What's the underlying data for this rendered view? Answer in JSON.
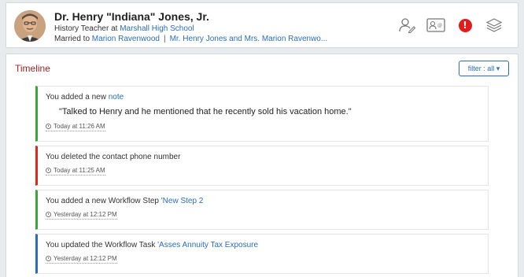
{
  "profile": {
    "name": "Dr. Henry \"Indiana\" Jones, Jr.",
    "role_prefix": "History Teacher at ",
    "school": "Marshall High School",
    "married_prefix": "Married to ",
    "spouse": "Marion Ravenwood",
    "separator": "|",
    "household": "Mr. Henry Jones and Mrs. Marion Ravenwo..."
  },
  "header_icons": [
    "person-edit-icon",
    "contact-card-icon",
    "alert-icon",
    "layers-icon"
  ],
  "alert_glyph": "!",
  "timeline": {
    "title": "Timeline",
    "filter_label": "filter : all ▾",
    "entries": [
      {
        "prefix": "You added a new ",
        "link": "note",
        "quote": "\"Talked to Henry and he mentioned that he recently sold his vacation home.\"",
        "time": "Today at 11:26 AM",
        "color": "#3aa53a"
      },
      {
        "prefix": "You deleted the contact phone number",
        "link": "",
        "time": "Today at 11:25 AM",
        "color": "#e0261f"
      },
      {
        "prefix": "You added a new Workflow Step ",
        "link": "'New Step 2",
        "time": "Yesterday at 12:12 PM",
        "color": "#3aa53a"
      },
      {
        "prefix": "You updated the Workflow Task ",
        "link": "'Asses Annuity Tax Exposure",
        "time": "Yesterday at 12:12 PM",
        "color": "#2a6ebb"
      }
    ]
  }
}
